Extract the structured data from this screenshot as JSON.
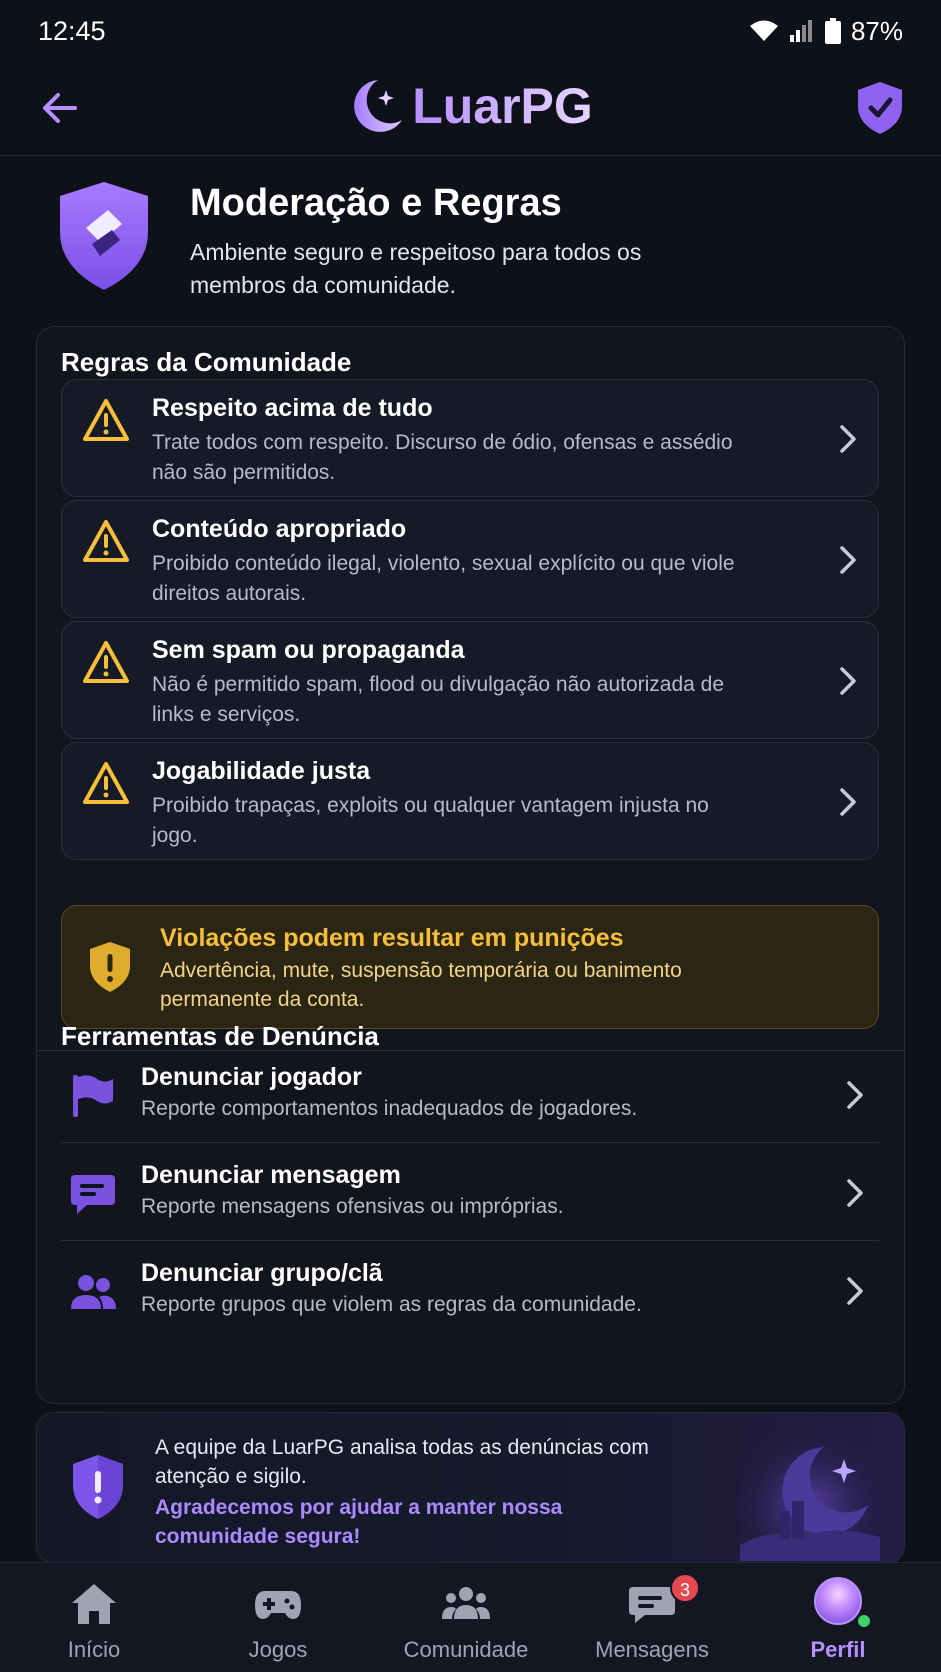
{
  "status_bar": {
    "time": "12:45",
    "battery": "87%"
  },
  "header": {
    "brand": "LuarPG"
  },
  "page": {
    "title": "Moderação e Regras",
    "subtitle": "Ambiente seguro e respeitoso para todos os membros da comunidade."
  },
  "rules_section": {
    "title": "Regras da Comunidade",
    "items": [
      {
        "title": "Respeito acima de tudo",
        "desc": "Trate todos com respeito. Discurso de ódio, ofensas e assédio não são permitidos."
      },
      {
        "title": "Conteúdo apropriado",
        "desc": "Proibido conteúdo ilegal, violento, sexual explícito ou que viole direitos autorais."
      },
      {
        "title": "Sem spam ou propaganda",
        "desc": "Não é permitido spam, flood ou divulgação não autorizada de links e serviços."
      },
      {
        "title": "Jogabilidade justa",
        "desc": "Proibido trapaças, exploits ou qualquer vantagem injusta no jogo."
      }
    ],
    "warning": {
      "title": "Violações podem resultar em punições",
      "desc": "Advertência, mute, suspensão temporária ou banimento permanente da conta."
    }
  },
  "report_section": {
    "title": "Ferramentas de Denúncia",
    "items": [
      {
        "title": "Denunciar jogador",
        "desc": "Reporte comportamentos inadequados de jogadores.",
        "icon": "flag-icon"
      },
      {
        "title": "Denunciar mensagem",
        "desc": "Reporte mensagens ofensivas ou impróprias.",
        "icon": "message-icon"
      },
      {
        "title": "Denunciar grupo/clã",
        "desc": "Reporte grupos que violem as regras da comunidade.",
        "icon": "group-icon"
      }
    ]
  },
  "info": {
    "text": "A equipe da LuarPG analisa todas as denúncias com atenção e sigilo.",
    "highlight": "Agradecemos por ajudar a manter nossa comunidade segura!"
  },
  "nav": {
    "items": [
      {
        "label": "Início",
        "icon": "home-icon"
      },
      {
        "label": "Jogos",
        "icon": "gamepad-icon"
      },
      {
        "label": "Comunidade",
        "icon": "community-icon"
      },
      {
        "label": "Mensagens",
        "icon": "messages-icon",
        "badge": "3"
      },
      {
        "label": "Perfil",
        "icon": "avatar",
        "active": true
      }
    ]
  },
  "colors": {
    "accent": "#b690ff",
    "background": "#0f111a",
    "warning": "#f5bf3b",
    "badge": "#e5484d",
    "online": "#3fd26b"
  }
}
